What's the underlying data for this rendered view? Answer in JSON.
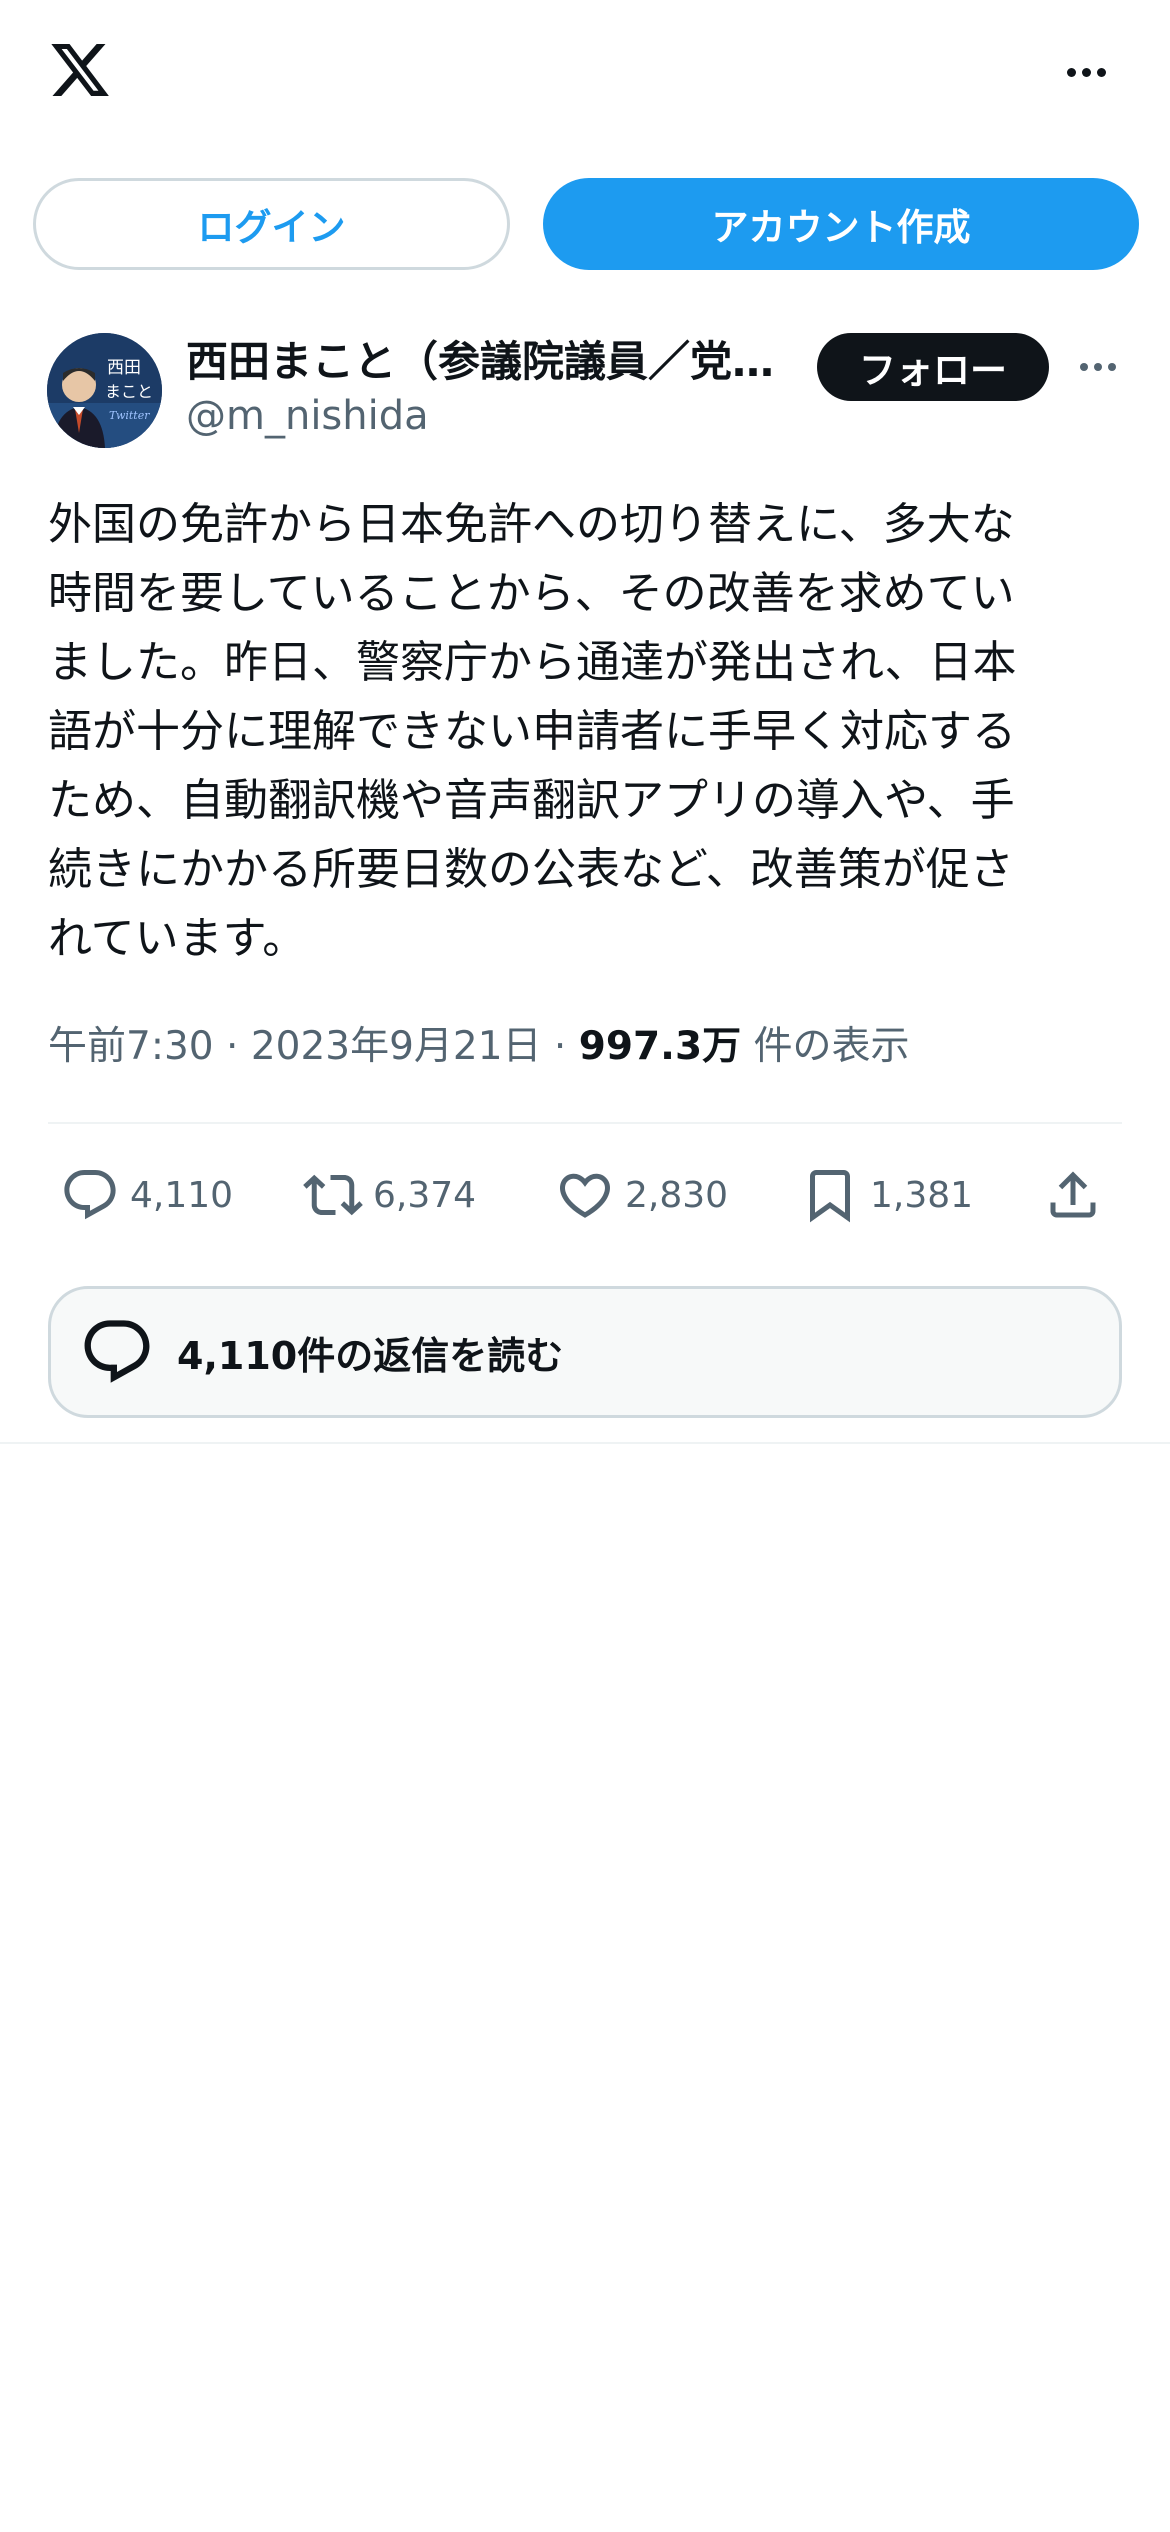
{
  "header": {
    "logo_icon": "x-logo-icon",
    "more_icon": "more-horizontal-icon"
  },
  "auth": {
    "login_label": "ログイン",
    "signup_label": "アカウント作成"
  },
  "post": {
    "author_name": "西田まこと（参議院議員／党…",
    "author_handle": "@m_nishida",
    "avatar_text": "西田まこと Twitter",
    "follow_label": "フォロー",
    "text": "外国の免許から日本免許への切り替えに、多大な\n時間を要していることから、その改善を求めてい\nました。昨日、警察庁から通達が発出され、日本\n語が十分に理解できない申請者に手早く対応する\nため、自動翻訳機や音声翻訳アプリの導入や、手\n続きにかかる所要日数の公表など、改善策が促さ\nれています。",
    "time": "午前7:30",
    "date": "2023年9月21日",
    "views_count": "997.3万",
    "views_label": "件の表示",
    "separator": "·"
  },
  "actions": {
    "replies": "4,110",
    "reposts": "6,374",
    "likes": "2,830",
    "bookmarks": "1,381"
  },
  "read_replies_label": "4,110件の返信を読む",
  "colors": {
    "accent": "#1d9bf0",
    "text": "#0f1419",
    "muted": "#536471",
    "border": "#cfd9de"
  }
}
